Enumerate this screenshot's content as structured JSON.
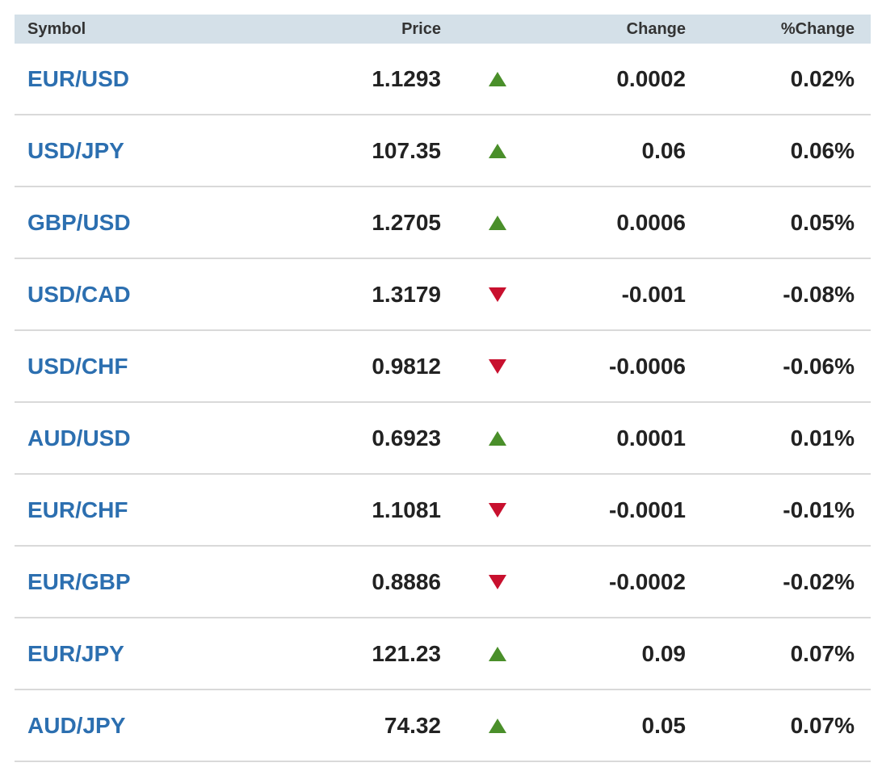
{
  "colors": {
    "header_bg": "#d4e0e8",
    "symbol_link": "#2c6fb0",
    "up": "#4a8f2a",
    "down": "#c8102e"
  },
  "header": {
    "symbol": "Symbol",
    "price": "Price",
    "change": "Change",
    "pct_change": "%Change"
  },
  "rows": [
    {
      "symbol": "EUR/USD",
      "price": "1.1293",
      "direction": "up",
      "change": "0.0002",
      "pct": "0.02%"
    },
    {
      "symbol": "USD/JPY",
      "price": "107.35",
      "direction": "up",
      "change": "0.06",
      "pct": "0.06%"
    },
    {
      "symbol": "GBP/USD",
      "price": "1.2705",
      "direction": "up",
      "change": "0.0006",
      "pct": "0.05%"
    },
    {
      "symbol": "USD/CAD",
      "price": "1.3179",
      "direction": "down",
      "change": "-0.001",
      "pct": "-0.08%"
    },
    {
      "symbol": "USD/CHF",
      "price": "0.9812",
      "direction": "down",
      "change": "-0.0006",
      "pct": "-0.06%"
    },
    {
      "symbol": "AUD/USD",
      "price": "0.6923",
      "direction": "up",
      "change": "0.0001",
      "pct": "0.01%"
    },
    {
      "symbol": "EUR/CHF",
      "price": "1.1081",
      "direction": "down",
      "change": "-0.0001",
      "pct": "-0.01%"
    },
    {
      "symbol": "EUR/GBP",
      "price": "0.8886",
      "direction": "down",
      "change": "-0.0002",
      "pct": "-0.02%"
    },
    {
      "symbol": "EUR/JPY",
      "price": "121.23",
      "direction": "up",
      "change": "0.09",
      "pct": "0.07%"
    },
    {
      "symbol": "AUD/JPY",
      "price": "74.32",
      "direction": "up",
      "change": "0.05",
      "pct": "0.07%"
    }
  ]
}
